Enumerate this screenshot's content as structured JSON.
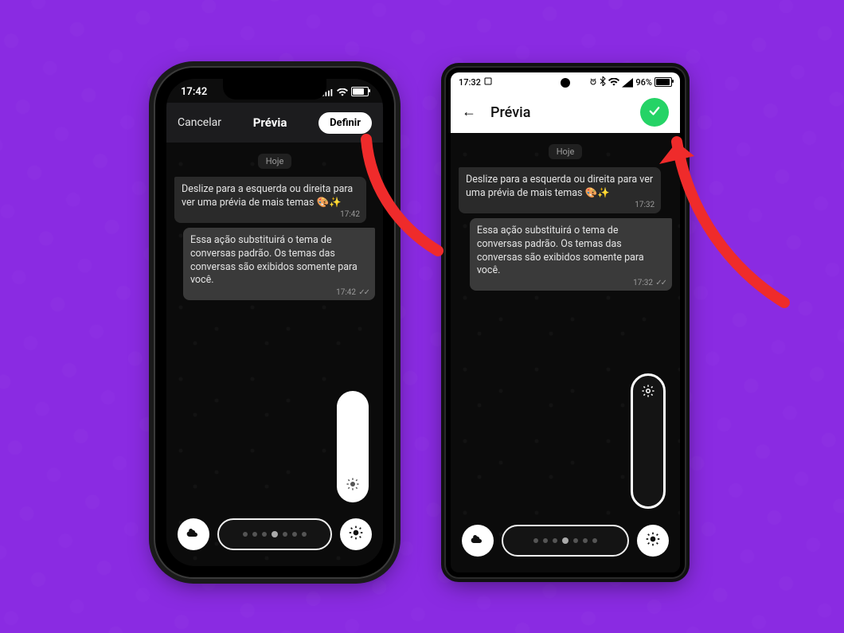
{
  "colors": {
    "background": "#8a2be2",
    "confirm_green": "#25d366",
    "arrow_red": "#ef2b2b"
  },
  "ios": {
    "status_time": "17:42",
    "header": {
      "cancel": "Cancelar",
      "title": "Prévia",
      "confirm": "Definir"
    },
    "chat": {
      "day": "Hoje",
      "msg_in": "Deslize para a esquerda ou direita para ver uma prévia de mais temas 🎨✨",
      "msg_in_time": "17:42",
      "msg_out": "Essa ação substituirá o tema de conversas padrão. Os temas das conversas são exibidos somente para você.",
      "msg_out_time": "17:42"
    }
  },
  "android": {
    "status_time": "17:32",
    "status_battery": "96%",
    "header": {
      "title": "Prévia"
    },
    "chat": {
      "day": "Hoje",
      "msg_in": "Deslize para a esquerda ou direita para ver uma prévia de mais temas 🎨✨",
      "msg_in_time": "17:32",
      "msg_out": "Essa ação substituirá o tema de conversas padrão. Os temas das conversas são exibidos somente para você.",
      "msg_out_time": "17:32"
    }
  }
}
